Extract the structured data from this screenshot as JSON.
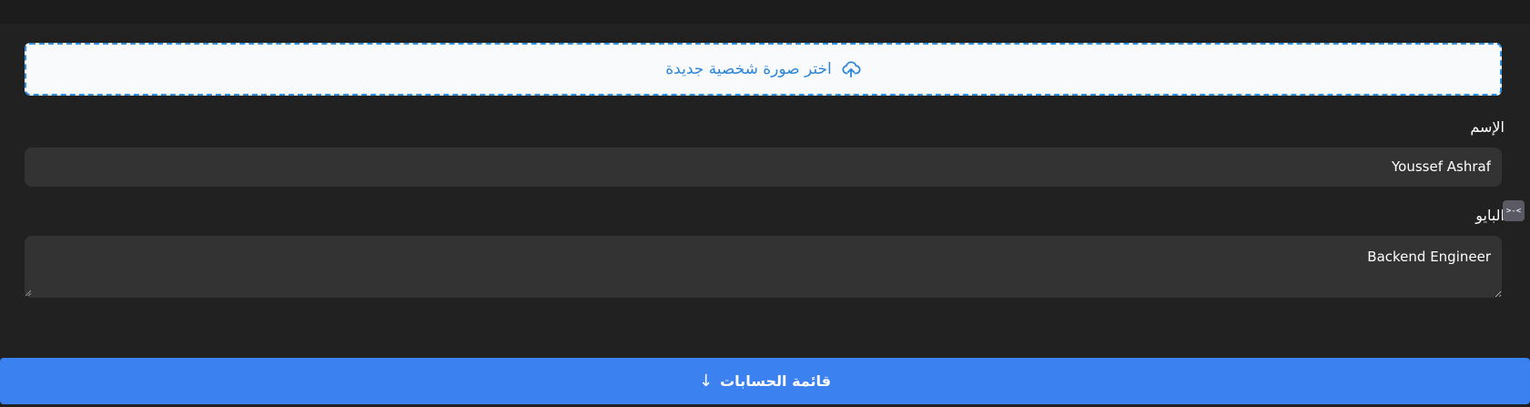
{
  "upload": {
    "label": "اختر صورة شخصية جديدة",
    "icon": "cloud-upload-icon",
    "accent_color": "#2f86d6"
  },
  "form": {
    "name_label": "الإسم",
    "name_value": "Youssef Ashraf",
    "bio_label": "البايو",
    "bio_value": "Backend Engineer"
  },
  "accounts_button": {
    "label": "قائمة الحسابات",
    "icon": "arrow-down-icon",
    "color": "#3b82f0"
  },
  "extension_icon": {
    "glyph": ">-<"
  }
}
